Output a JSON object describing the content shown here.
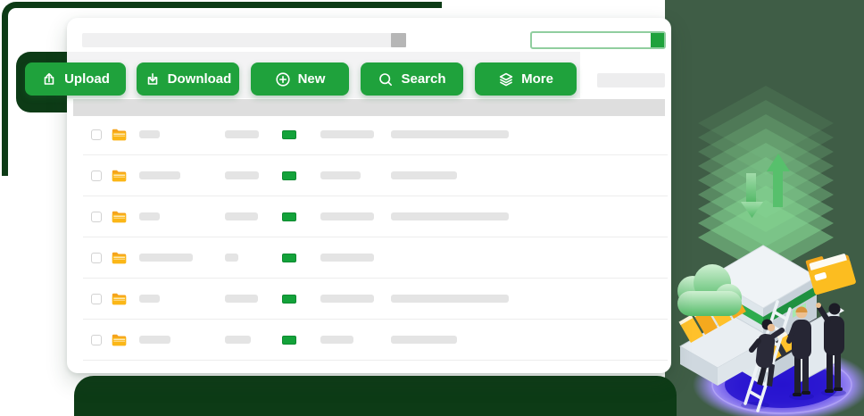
{
  "toolbar": {
    "buttons": [
      {
        "label": "Upload",
        "icon": "upload-icon"
      },
      {
        "label": "Download",
        "icon": "download-icon"
      },
      {
        "label": "New",
        "icon": "plus-circle-icon"
      },
      {
        "label": "Search",
        "icon": "search-icon"
      },
      {
        "label": "More",
        "icon": "layers-icon"
      }
    ],
    "right_placeholder_bar": true
  },
  "top_bar": {
    "address_placeholder": true,
    "scroll_knob_position": "right",
    "progress_fill_percent": 10
  },
  "table": {
    "columns": [
      "checkbox",
      "folder-icon",
      "name",
      "size",
      "status-badge",
      "detail",
      "extra"
    ],
    "rows": [
      {
        "name_w": 23,
        "size_w": 38,
        "detail_w": 60,
        "extra_w": 132
      },
      {
        "name_w": 46,
        "size_w": 38,
        "detail_w": 45,
        "extra_w": 74
      },
      {
        "name_w": 23,
        "size_w": 37,
        "detail_w": 60,
        "extra_w": 132
      },
      {
        "name_w": 60,
        "size_w": 15,
        "detail_w": 60,
        "extra_w": 0
      },
      {
        "name_w": 23,
        "size_w": 37,
        "detail_w": 60,
        "extra_w": 132
      },
      {
        "name_w": 35,
        "size_w": 29,
        "detail_w": 37,
        "extra_w": 74
      }
    ]
  },
  "colors": {
    "brand_green": "#1FA23C",
    "dark_green": "#0D3B16",
    "background_green": "#3F5D46",
    "badge_green": "#13A23A",
    "folder_yellow": "#FBB717",
    "skeleton_gray": "#E4E4E4",
    "header_gray": "#DEDEDE",
    "knob_gray": "#B6B6B6",
    "disc_purple": "#2A14D6"
  },
  "illustration": {
    "description": "isometric file cabinet with up/down transfer arrows, green layered backdrop, green cloud, yellow folders, open drawers, ladder and three people on a purple disc",
    "elements": [
      "layered-backdrop",
      "up-down-arrows",
      "file-cabinet",
      "green-cloud",
      "yellow-folder",
      "open-drawer-with-folders",
      "drawer-panel",
      "ladder",
      "person-climbing",
      "person-blond",
      "person-pointing",
      "purple-floor-disc"
    ]
  }
}
